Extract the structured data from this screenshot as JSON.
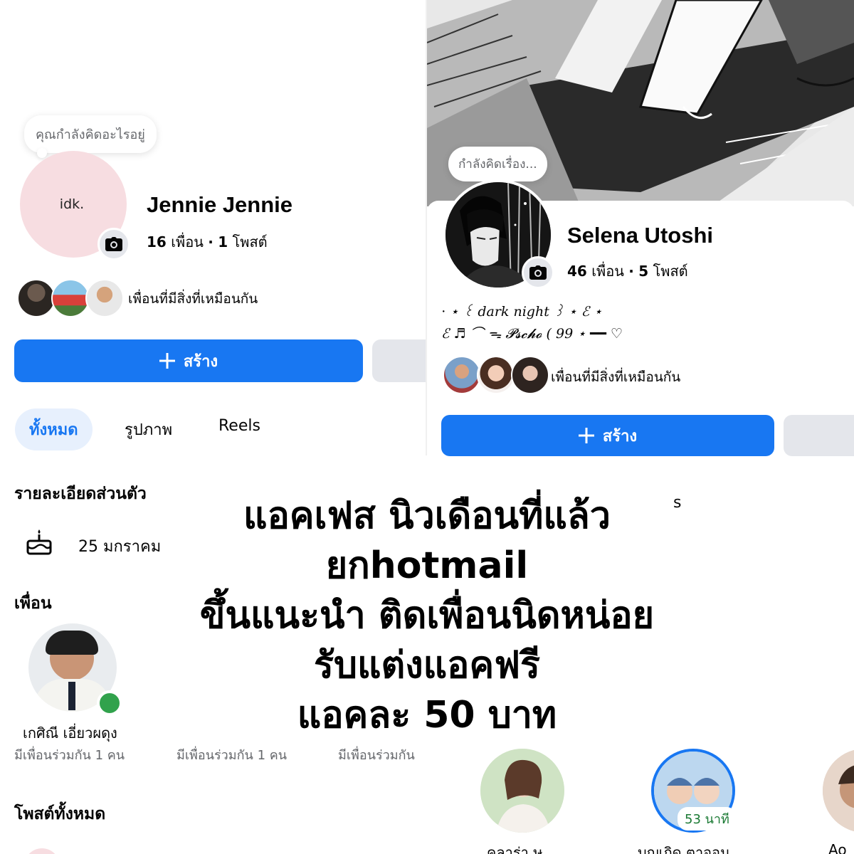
{
  "left_profile": {
    "status_prompt": "คุณกำลังคิดอะไรอยู่",
    "avatar_text": "idk.",
    "name": "Jennie Jennie",
    "friends_count": "16",
    "friends_label": "เพื่อน",
    "posts_count": "1",
    "posts_label": "โพสต์",
    "separator": "·",
    "mutual_label": "เพื่อนที่มีสิ่งที่เหมือนกัน",
    "create_button": "สร้าง",
    "tabs": [
      "ทั้งหมด",
      "รูปภาพ",
      "Reels"
    ],
    "details_title": "รายละเอียดส่วนตัว",
    "birthday": "25 มกราคม",
    "friends_title": "เพื่อน",
    "friend_name": "เกศิณี เอี่ยวผดุง",
    "mutual_friends": [
      "มีเพื่อนร่วมกัน 1 คน",
      "มีเพื่อนร่วมกัน 1 คน",
      "มีเพื่อนร่วมกัน"
    ],
    "all_posts_title": "โพสต์ทั้งหมด"
  },
  "right_profile": {
    "status_prompt": "กำลังคิดเรื่อง...",
    "name": "Selena Utoshi",
    "friends_count": "46",
    "friends_label": "เพื่อน",
    "posts_count": "5",
    "posts_label": "โพสต์",
    "separator": "·",
    "bio_line1": "⋅ ⋆ ꒰ dark night ꒱ ⋆ ℰ ⋆",
    "bio_line2": "ℰ ♬ ⌒ ᯓ 𝓟𝓼𝓬𝓱𝓸 ( 99 ⋆ ━━ ♡",
    "mutual_label": "เพื่อนที่มีสิ่งที่เหมือนกัน",
    "create_button": "สร้าง",
    "hidden_tab_tail": "s",
    "story_badge": "53 นาที",
    "story_names": [
      "คลาร่า ษ",
      "บุญเกิด ตาจอม",
      "Ao"
    ]
  },
  "overlay": {
    "lines": [
      "แอคเฟส นิวเดือนที่แล้ว",
      "ยกhotmail",
      "ขึ้นแนะนำ ติดเพื่อนนิดหน่อย",
      "รับแต่งแอคฟรี",
      "แอคละ 50 บาท"
    ]
  },
  "colors": {
    "accent": "#1877f2",
    "secondary_button": "#e4e6eb",
    "active_tab_bg": "#e7f0fd",
    "online": "#31a24c",
    "text": "#050505",
    "muted": "#65676b"
  },
  "icons": [
    "camera-icon",
    "plus-icon",
    "birthday-cake-icon"
  ]
}
